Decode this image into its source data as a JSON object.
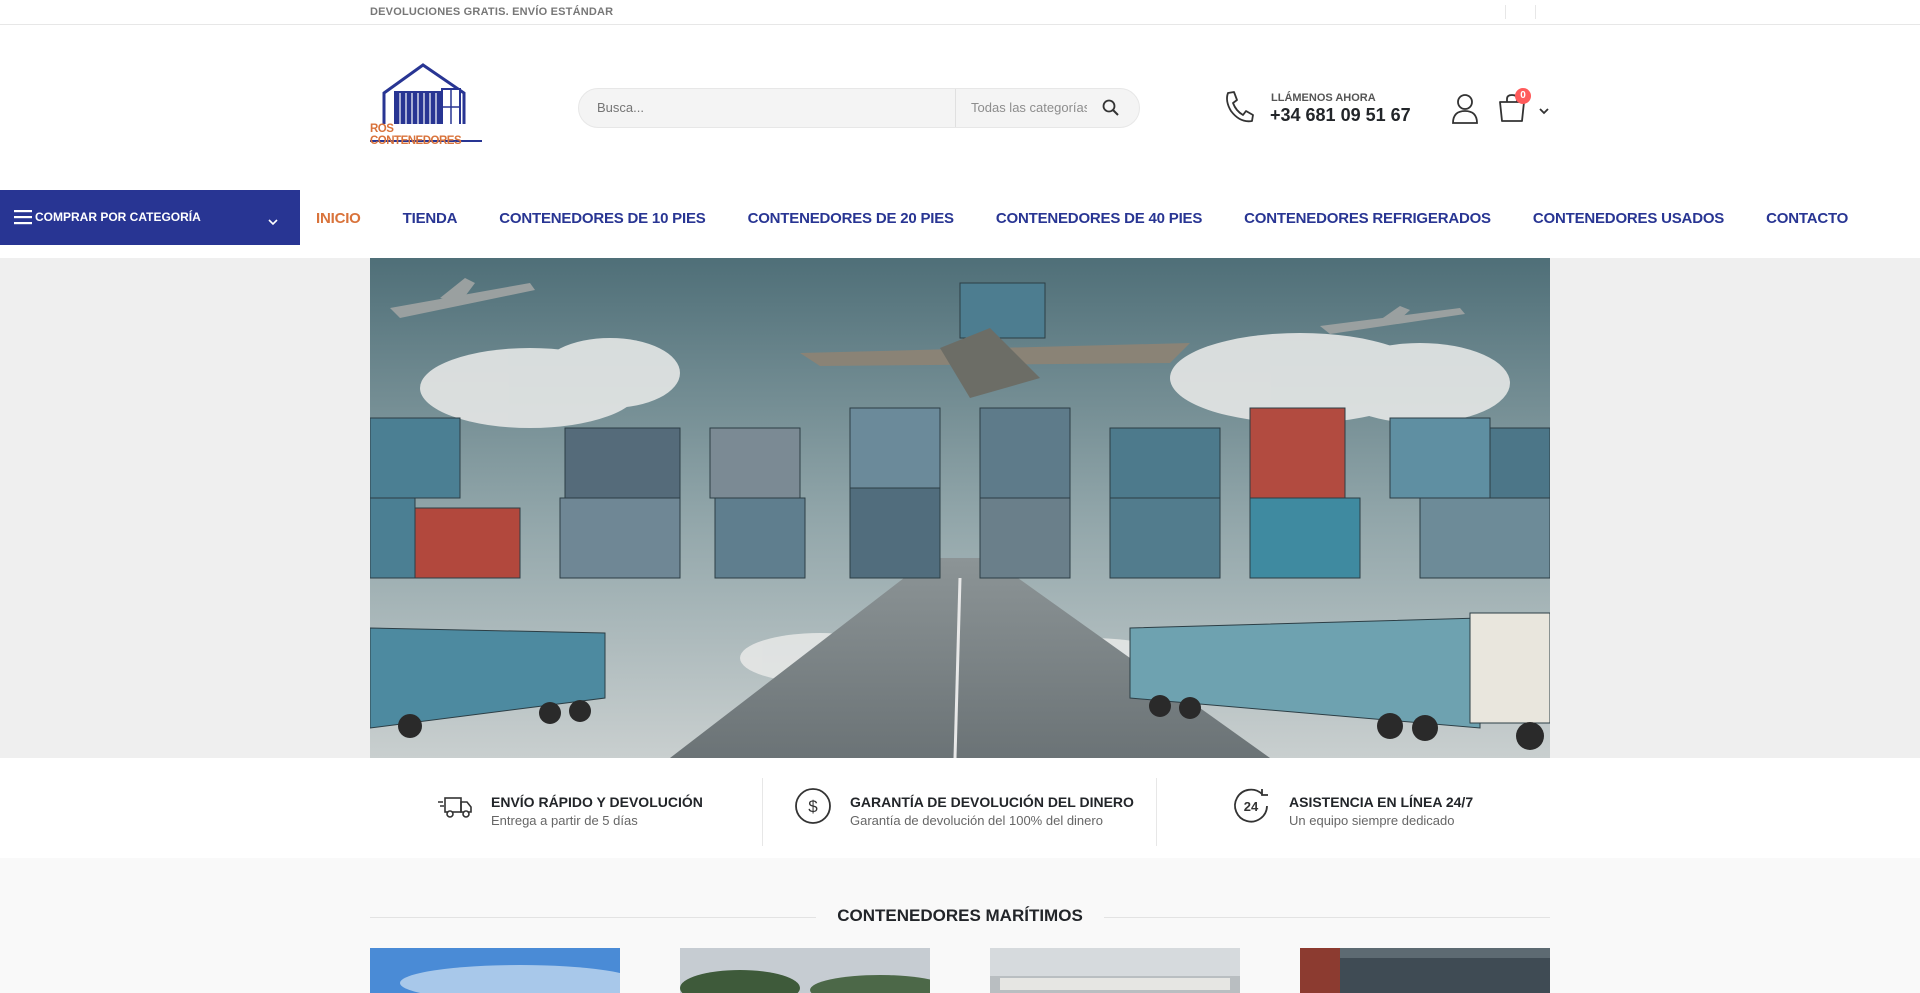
{
  "topbar": {
    "text": "DEVOLUCIONES GRATIS. ENVÍO ESTÁNDAR"
  },
  "header": {
    "logo_text": "ROS CONTENEDORES",
    "search": {
      "placeholder": "Busca...",
      "category": "Todas las categorías"
    },
    "call_label": "LLÁMENOS AHORA",
    "phone": "+34 681 09 51 67",
    "cart_count": "0"
  },
  "nav": {
    "category_button": "COMPRAR POR CATEGORÍA",
    "items": [
      "INICIO",
      "TIENDA",
      "CONTENEDORES DE 10 PIES",
      "CONTENEDORES DE 20 PIES",
      "CONTENEDORES DE 40 PIES",
      "CONTENEDORES REFRIGERADOS",
      "CONTENEDORES USADOS",
      "CONTACTO"
    ],
    "active_index": 0
  },
  "features": [
    {
      "icon": "truck-icon",
      "title": "ENVÍO RÁPIDO Y DEVOLUCIÓN",
      "subtitle": "Entrega a partir de 5 días"
    },
    {
      "icon": "dollar-icon",
      "title": "GARANTÍA DE DEVOLUCIÓN DEL DINERO",
      "subtitle": "Garantía de devolución del 100% del dinero"
    },
    {
      "icon": "support-24-icon",
      "title": "ASISTENCIA EN LÍNEA 24/7",
      "subtitle": "Un equipo siempre dedicado"
    }
  ],
  "section": {
    "title": "CONTENEDORES MARÍTIMOS"
  },
  "colors": {
    "brand_blue": "#283593",
    "accent_orange": "#d9733b",
    "badge_red": "#ff5b5b"
  }
}
